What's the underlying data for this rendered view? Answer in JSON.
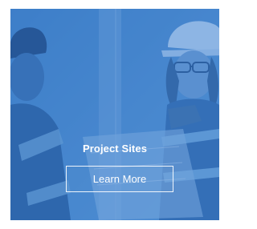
{
  "card": {
    "title": "Project Sites",
    "button_label": "Learn More"
  },
  "colors": {
    "overlay": "#2e76cd",
    "text": "#ffffff"
  }
}
